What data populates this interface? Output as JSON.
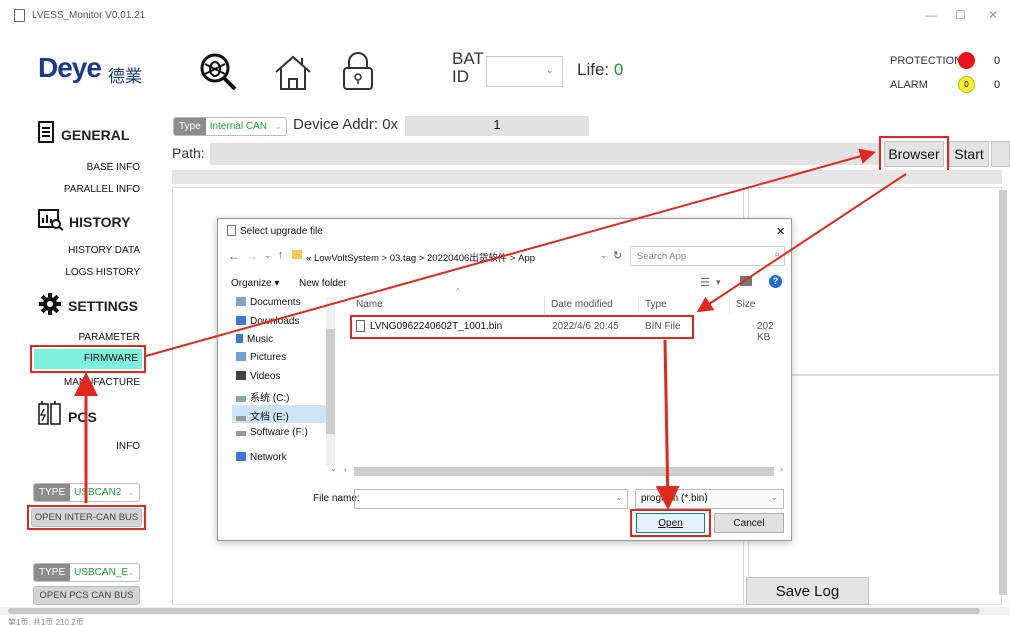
{
  "window": {
    "title": "LVESS_Monitor V0.01.21",
    "controls": [
      "—",
      "☐",
      "✕"
    ]
  },
  "header": {
    "logo_text": "Deye",
    "logo_cn": "德業",
    "bat_id_label": "BAT ID",
    "bat_id_value": "",
    "life_label": "Life:",
    "life_value": "0",
    "protection_label": "PROTECTION",
    "protection_value": "0",
    "alarm_label": "ALARM",
    "alarm_value": "0",
    "alarm_dot_text": "0",
    "colors": {
      "protection": "#e8141a",
      "alarm": "#ffef3a",
      "life": "#1c9e3a"
    }
  },
  "sidebar": {
    "general": {
      "title": "GENERAL",
      "items": [
        "BASE INFO",
        "PARALLEL INFO"
      ]
    },
    "history": {
      "title": "HISTORY",
      "items": [
        "HISTORY DATA",
        "LOGS HISTORY"
      ]
    },
    "settings": {
      "title": "SETTINGS",
      "items": [
        "PARAMETER",
        "FIRMWARE",
        "MANUFACTURE"
      ]
    },
    "pcs": {
      "title": "PCS",
      "items": [
        "INFO"
      ]
    },
    "can1": {
      "type_label": "TYPE",
      "value": "USBCAN2",
      "button": "OPEN INTER-CAN BUS"
    },
    "can2": {
      "type_label": "TYPE",
      "value": "USBCAN_E",
      "button": "OPEN PCS CAN BUS"
    }
  },
  "main": {
    "type_label": "Type",
    "type_value": "Internal CAN",
    "device_addr_label": "Device Addr: 0x",
    "device_addr_value": "1",
    "path_label": "Path:",
    "path_value": "",
    "browser_button": "Browser",
    "start_button": "Start",
    "save_log_button": "Save Log"
  },
  "dialog": {
    "title": "Select upgrade file",
    "close": "✕",
    "breadcrumb": [
      "«",
      "LowVoltSystem",
      ">",
      "03.tag",
      ">",
      "20220406出货软件",
      ">",
      "App"
    ],
    "search_placeholder": "Search App",
    "organize": "Organize ▾",
    "new_folder": "New folder",
    "nav": [
      {
        "label": "Documents",
        "icon": "documents-icon"
      },
      {
        "label": "Downloads",
        "icon": "downloads-icon"
      },
      {
        "label": "Music",
        "icon": "music-icon"
      },
      {
        "label": "Pictures",
        "icon": "pictures-icon"
      },
      {
        "label": "Videos",
        "icon": "videos-icon"
      },
      {
        "label": "系统 (C:)",
        "icon": "drive-icon"
      },
      {
        "label": "文档 (E:)",
        "icon": "drive-icon"
      },
      {
        "label": "Software (F:)",
        "icon": "drive-icon"
      },
      {
        "label": "Network",
        "icon": "network-icon"
      }
    ],
    "columns": [
      "Name",
      "Date modified",
      "Type",
      "Size"
    ],
    "files": [
      {
        "name": "LVNG0962240602T_1001.bin",
        "date": "2022/4/6 20:45",
        "type": "BIN File",
        "size": "202 KB"
      }
    ],
    "file_name_label": "File name:",
    "file_name_value": "",
    "filter": "program (*.bin)",
    "open_button": "Open",
    "cancel_button": "Cancel"
  },
  "statusbar": {
    "text": "第1页, 共1页  210.2页"
  }
}
